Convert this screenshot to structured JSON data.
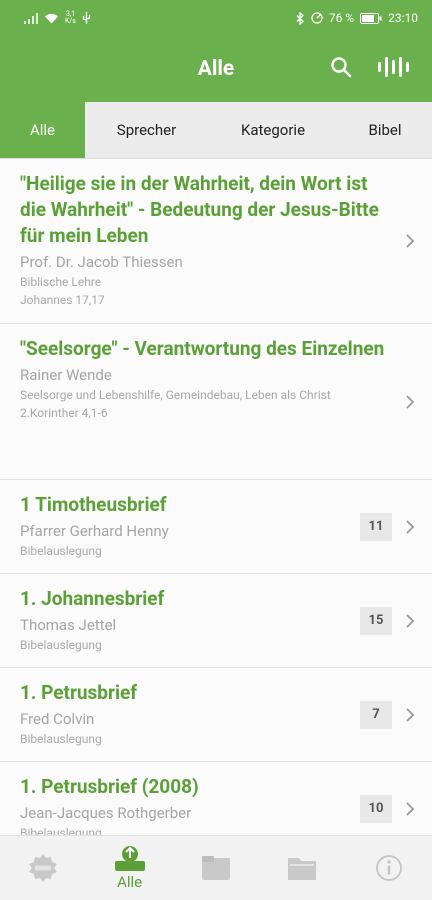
{
  "status_bar": {
    "net_speed_value": "3,1",
    "net_speed_unit": "K/s",
    "battery_percent": "76 %",
    "time": "23:10"
  },
  "toolbar": {
    "title": "Alle"
  },
  "tabs": [
    {
      "label": "Alle",
      "active": true
    },
    {
      "label": "Sprecher",
      "active": false
    },
    {
      "label": "Kategorie",
      "active": false
    },
    {
      "label": "Bibel",
      "active": false
    }
  ],
  "list": [
    {
      "title": "\"Heilige sie in der Wahrheit, dein Wort ist die Wahrheit\" - Bedeutung der Jesus-Bitte für mein Leben",
      "speaker": "Prof. Dr. Jacob Thiessen",
      "category": "Biblische Lehre",
      "reference": "Johannes 17,17",
      "count": ""
    },
    {
      "title": "\"Seelsorge\" - Verantwortung des Einzelnen",
      "speaker": "Rainer Wende",
      "category": "Seelsorge und Lebenshilfe, Gemeindebau, Leben als Christ",
      "reference": "2.Korinther 4,1-6",
      "count": ""
    },
    {
      "title": "1 Timotheusbrief",
      "speaker": "Pfarrer Gerhard Henny",
      "category": "Bibelauslegung",
      "reference": "",
      "count": "11"
    },
    {
      "title": "1. Johannesbrief",
      "speaker": "Thomas Jettel",
      "category": "Bibelauslegung",
      "reference": "",
      "count": "15"
    },
    {
      "title": "1. Petrusbrief",
      "speaker": "Fred Colvin",
      "category": "Bibelauslegung",
      "reference": "",
      "count": "7"
    },
    {
      "title": "1. Petrusbrief (2008)",
      "speaker": "Jean-Jacques Rothgerber",
      "category": "Bibelauslegung",
      "reference": "",
      "count": "10"
    }
  ],
  "bottom_nav": {
    "items": [
      {
        "icon": "new-icon",
        "label": "",
        "active": false
      },
      {
        "icon": "all-icon",
        "label": "Alle",
        "active": true
      },
      {
        "icon": "folder-icon",
        "label": "",
        "active": false
      },
      {
        "icon": "folder-icon",
        "label": "",
        "active": false
      },
      {
        "icon": "info-icon",
        "label": "",
        "active": false
      }
    ]
  },
  "colors": {
    "accent": "#6ab04c",
    "title_green": "#5aa037",
    "gray_text": "#a5a5a5"
  }
}
